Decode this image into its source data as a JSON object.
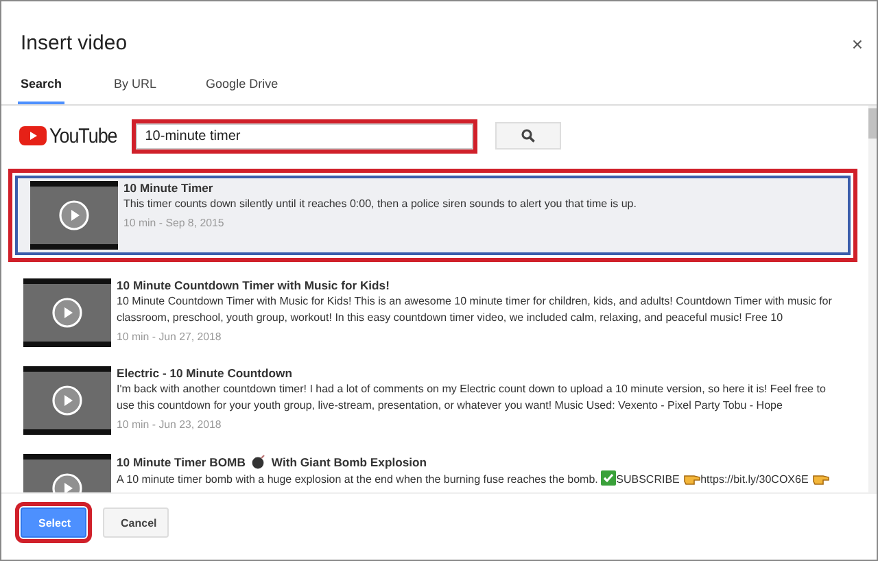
{
  "dialog": {
    "title": "Insert video",
    "close": "×"
  },
  "tabs": [
    {
      "label": "Search",
      "selected": true
    },
    {
      "label": "By URL",
      "selected": false
    },
    {
      "label": "Google Drive",
      "selected": false
    }
  ],
  "search": {
    "logo_text": "YouTube",
    "value": "10-minute timer",
    "highlighted": true
  },
  "results": [
    {
      "title": [
        "10 Minute Timer"
      ],
      "description": [
        {
          "text": "This timer counts down silently until it reaches 0:00, then a police siren sounds to alert you that time is up."
        }
      ],
      "meta": "10 min - Sep 8, 2015",
      "selected": true,
      "highlighted": true
    },
    {
      "title": [
        "10 Minute Countdown Timer with Music for Kids!"
      ],
      "description": [
        {
          "text": "10 Minute Countdown Timer with Music for Kids! This is an awesome 10 minute timer for children, kids, and adults! Countdown Timer with music for classroom, preschool, youth group, workout! In this easy countdown timer video, we included calm, relaxing, and peaceful music! Free 10"
        }
      ],
      "meta": "10 min - Jun 27, 2018",
      "selected": false
    },
    {
      "title": [
        "Electric - 10 Minute Countdown"
      ],
      "description": [
        {
          "text": "I'm back with another countdown timer! I had a lot of comments on my Electric count down to upload a 10 minute version, so here it is! Feel free to use this countdown for your youth group, live-stream, presentation, or whatever you want! Music Used: Vexento - Pixel Party Tobu - Hope"
        }
      ],
      "meta": "10 min - Jun 23, 2018",
      "selected": false
    },
    {
      "title": [
        "10 Minute Timer BOMB",
        "With Giant Bomb Explosion"
      ],
      "description": [
        {
          "text": "A 10 minute timer bomb with a huge explosion at the end when the burning fuse reaches the bomb."
        },
        {
          "kind": "check",
          "text": "SUBSCRIBE"
        },
        {
          "kind": "hand",
          "text": "https://bit.ly/30COX6E"
        },
        {
          "kind": "hand"
        }
      ],
      "selected": false
    }
  ],
  "buttons": [
    {
      "label": "Select",
      "kind": "primary",
      "highlighted": true
    },
    {
      "label": "Cancel",
      "kind": "secondary",
      "highlighted": false
    }
  ]
}
